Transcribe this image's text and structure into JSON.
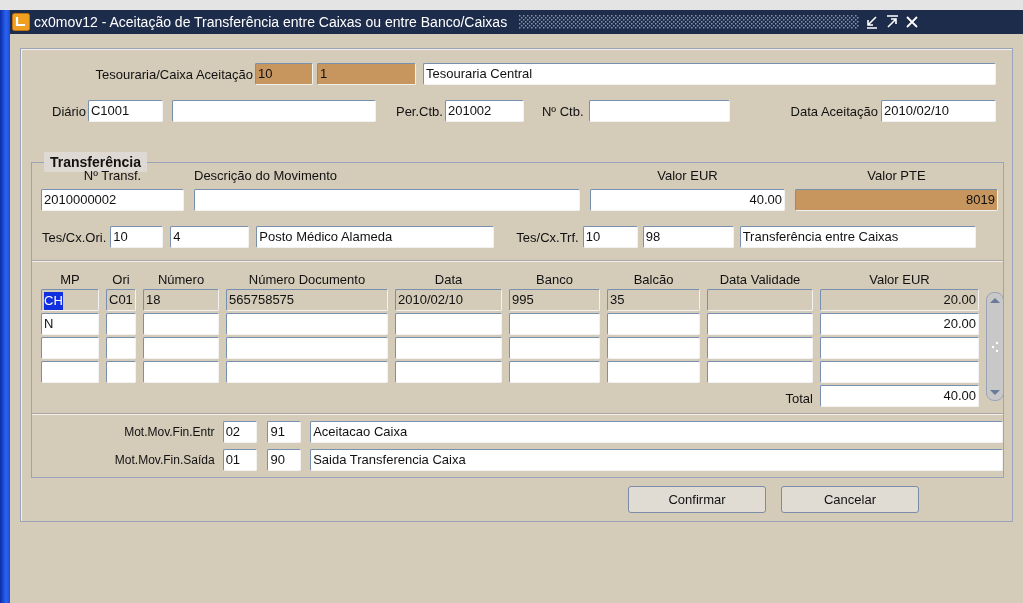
{
  "window": {
    "title": "cx0mov12 - Aceitação de Transferência entre Caixas ou entre Banco/Caixas"
  },
  "acceptance": {
    "label": "Tesouraria/Caixa Aceitação",
    "treasury": {
      "value": "10",
      "highlighted": true
    },
    "cash_box": {
      "value": "1",
      "highlighted": true
    },
    "name": {
      "value": "Tesouraria Central",
      "highlighted": false
    }
  },
  "journal": {
    "label": "Diário",
    "code": {
      "value": "C1001",
      "highlighted": false
    },
    "description": {
      "highlighted": false
    }
  },
  "period": {
    "label": "Per.Ctb.",
    "field": {
      "value": "201002",
      "highlighted": false
    }
  },
  "entry_no": {
    "label": "Nº Ctb.",
    "field": {
      "highlighted": false
    }
  },
  "acceptance_date": {
    "label": "Data Aceitação",
    "field": {
      "value": "2010/02/10",
      "highlighted": false
    }
  },
  "transfer": {
    "title": "Transferência",
    "columns": [
      "Nº Transf.",
      "Descrição do Movimento",
      "Valor EUR",
      "Valor PTE"
    ],
    "fields": [
      {
        "value": "2010000002",
        "highlighted": false
      },
      {
        "highlighted": false
      },
      {
        "value": "40.00",
        "highlighted": false
      },
      {
        "value": "8019",
        "highlighted": true
      }
    ],
    "origin": {
      "label": "Tes/Cx.Ori.",
      "treasury": {
        "value": "10",
        "highlighted": false
      },
      "cash_box": {
        "value": "4",
        "highlighted": false
      },
      "name": {
        "value": "Posto Médico Alameda",
        "highlighted": false
      }
    },
    "destination": {
      "label": "Tes/Cx.Trf.",
      "treasury": {
        "value": "10",
        "highlighted": false
      },
      "cash_box": {
        "value": "98",
        "highlighted": false
      },
      "name": {
        "value": "Transferência entre Caixas",
        "highlighted": false
      }
    }
  },
  "payments": {
    "columns": [
      "MP",
      "Ori",
      "Número",
      "Número Documento",
      "Data",
      "Banco",
      "Balcão",
      "Data Validade",
      "Valor EUR"
    ],
    "rows": [
      {
        "disabled": true,
        "cells": [
          {
            "text": "CH",
            "selected": true
          },
          {
            "text": "C01",
            "selected": false
          },
          {
            "text": "18",
            "selected": false
          },
          {
            "text": "565758575",
            "selected": false
          },
          {
            "text": "2010/02/10",
            "selected": false
          },
          {
            "text": "995",
            "selected": false
          },
          {
            "text": "35",
            "selected": false
          },
          {
            "selected": false
          },
          {
            "text": "20.00",
            "selected": false
          }
        ]
      },
      {
        "disabled": false,
        "cells": [
          {
            "text": "N",
            "selected": false
          },
          {
            "selected": false
          },
          {
            "selected": false
          },
          {
            "selected": false
          },
          {
            "selected": false
          },
          {
            "selected": false
          },
          {
            "selected": false
          },
          {
            "selected": false
          },
          {
            "text": "20.00",
            "selected": false
          }
        ]
      },
      {
        "disabled": false,
        "cells": [
          {
            "selected": false
          },
          {
            "selected": false
          },
          {
            "selected": false
          },
          {
            "selected": false
          },
          {
            "selected": false
          },
          {
            "selected": false
          },
          {
            "selected": false
          },
          {
            "selected": false
          },
          {
            "selected": false
          }
        ]
      },
      {
        "disabled": false,
        "cells": [
          {
            "selected": false
          },
          {
            "selected": false
          },
          {
            "selected": false
          },
          {
            "selected": false
          },
          {
            "selected": false
          },
          {
            "selected": false
          },
          {
            "selected": false
          },
          {
            "selected": false
          },
          {
            "selected": false
          }
        ]
      }
    ],
    "total": {
      "label": "Total",
      "field": {
        "value": "40.00",
        "highlighted": false
      }
    }
  },
  "reasons": [
    {
      "label": "Mot.Mov.Fin.Entr",
      "code": {
        "value": "02",
        "highlighted": false
      },
      "sub_code": {
        "value": "91",
        "highlighted": false
      },
      "description": {
        "value": "Aceitacao Caixa",
        "highlighted": false
      }
    },
    {
      "label": "Mot.Mov.Fin.Saída",
      "code": {
        "value": "01",
        "highlighted": false
      },
      "sub_code": {
        "value": "90",
        "highlighted": false
      },
      "description": {
        "value": "Saida Transferencia Caixa",
        "highlighted": false
      }
    }
  ],
  "buttons": [
    "Confirmar",
    "Cancelar"
  ]
}
